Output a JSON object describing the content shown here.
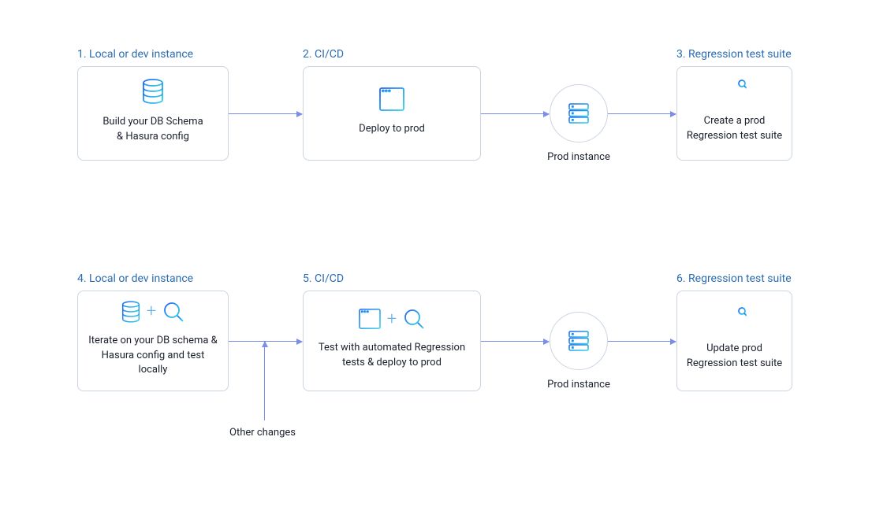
{
  "row1": {
    "step1": {
      "title": "1. Local or dev instance",
      "caption": "Build your DB Schema\n& Hasura config"
    },
    "step2": {
      "title": "2. CI/CD",
      "caption": "Deploy to prod"
    },
    "instance": {
      "label": "Prod instance"
    },
    "step3": {
      "title": "3. Regression test suite",
      "caption": "Create a prod\nRegression test suite"
    }
  },
  "row2": {
    "step4": {
      "title": "4. Local or dev instance",
      "caption": "Iterate on your DB schema &\nHasura config and test locally"
    },
    "step5": {
      "title": "5. CI/CD",
      "caption": "Test with automated Regression\ntests & deploy to prod"
    },
    "instance": {
      "label": "Prod instance"
    },
    "step6": {
      "title": "6. Regression test suite",
      "caption": "Update prod\nRegression test suite"
    },
    "other": "Other changes"
  },
  "colors": {
    "accent": "#2B6CB0",
    "arrow": "#7A8DE8",
    "border": "#CBD5E0"
  }
}
